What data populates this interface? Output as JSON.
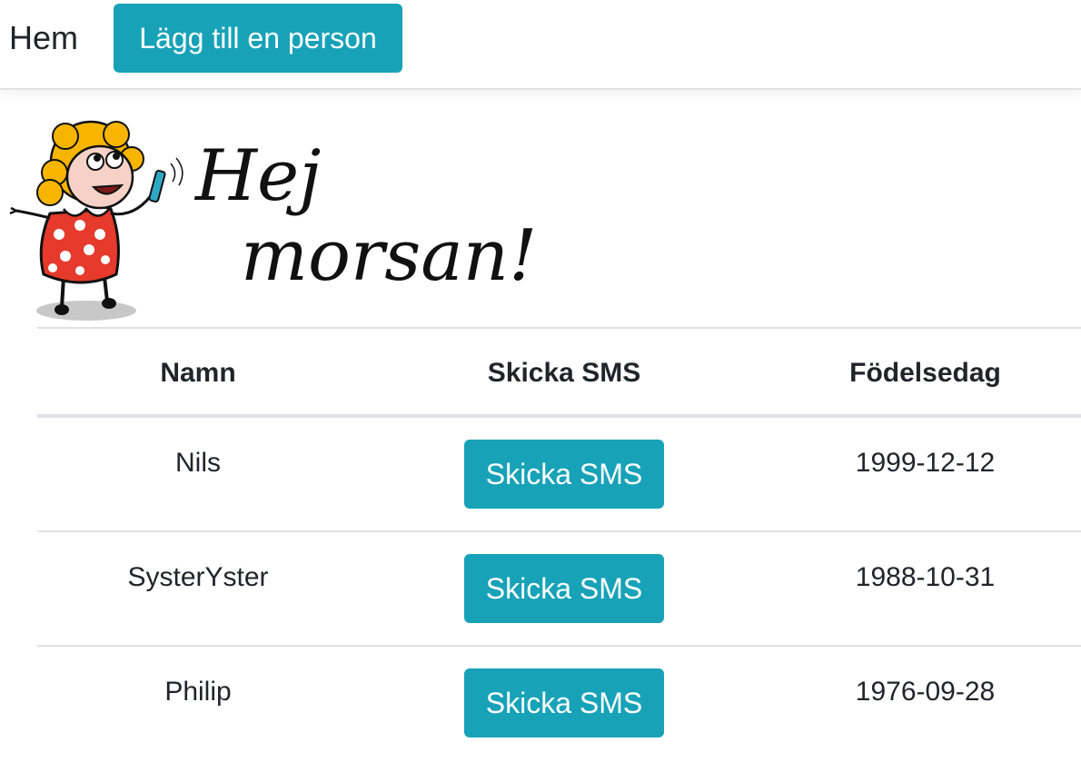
{
  "nav": {
    "home_label": "Hem",
    "add_person_label": "Lägg till en person"
  },
  "hero": {
    "line1": "Hej",
    "line2": "morsan!"
  },
  "table": {
    "headers": [
      "Namn",
      "Skicka SMS",
      "Födelsedag"
    ],
    "rows": [
      {
        "name": "Nils",
        "sms_label": "Skicka SMS",
        "birthday": "1999-12-12"
      },
      {
        "name": "SysterYster",
        "sms_label": "Skicka SMS",
        "birthday": "1988-10-31"
      },
      {
        "name": "Philip",
        "sms_label": "Skicka SMS",
        "birthday": "1976-09-28"
      }
    ]
  },
  "colors": {
    "accent": "#17a2b8",
    "border": "#dee2e6",
    "text": "#212529"
  }
}
